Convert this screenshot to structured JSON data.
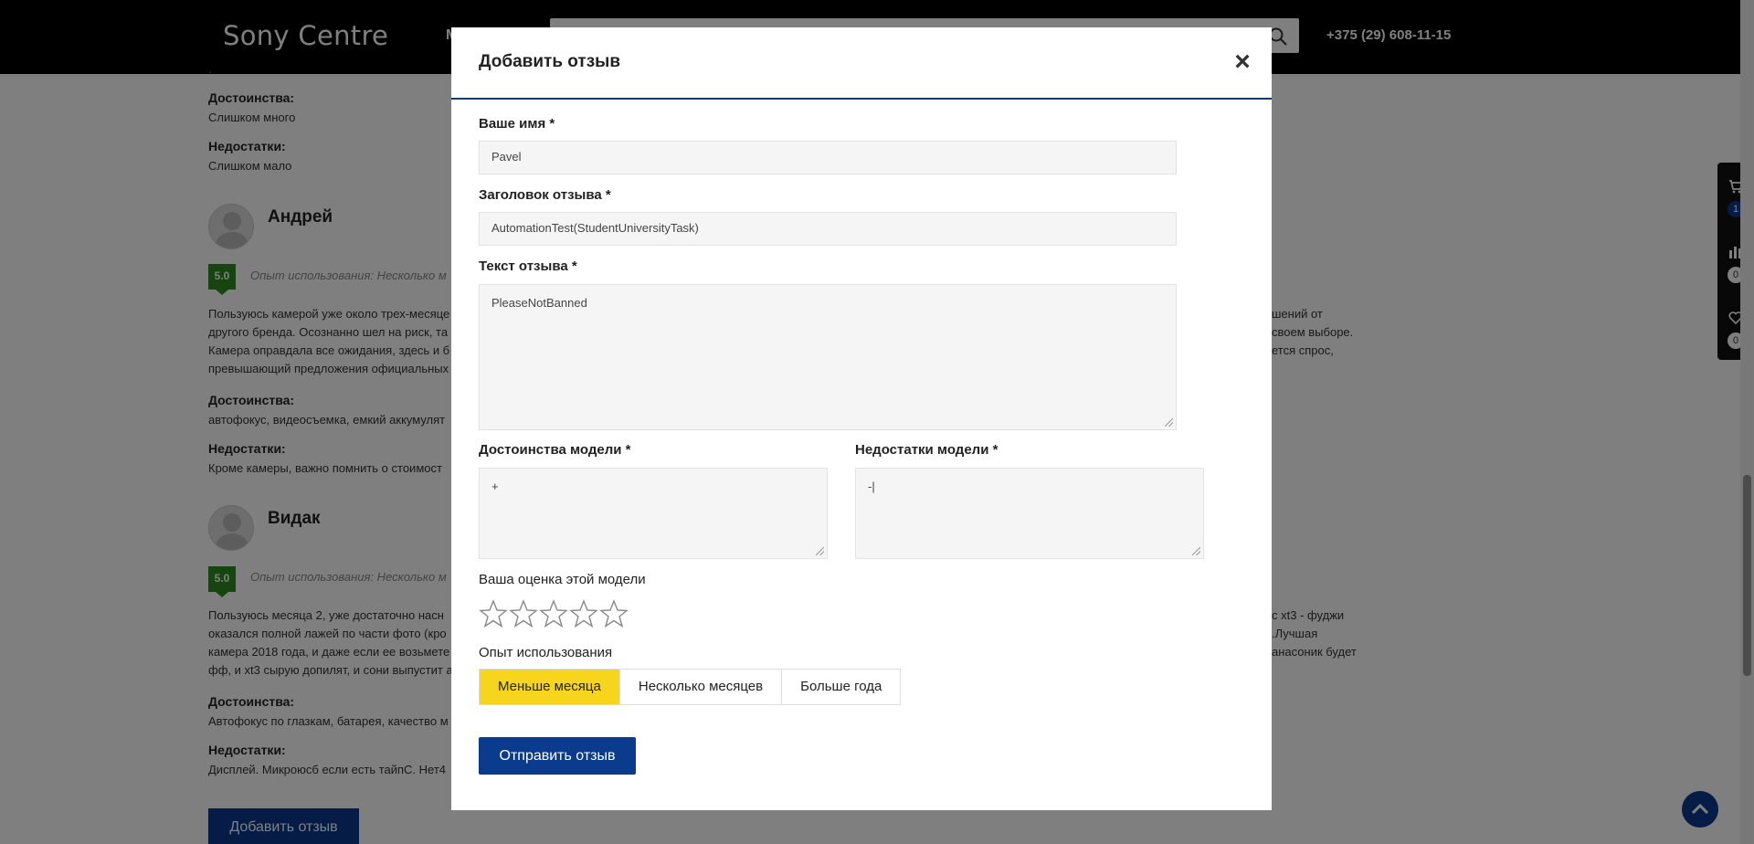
{
  "header": {
    "logo": "Sony Centre",
    "menu_peek": "М",
    "phone": "+375 (29) 608-11-15"
  },
  "reviews": {
    "first_partial": {
      "pros_label": "Достоинства:",
      "pros": "Слишком много",
      "cons_label": "Недостатки:",
      "cons": "Слишком мало"
    },
    "items": [
      {
        "name": "Андрей",
        "rating": "5.0",
        "experience": "Опыт использования: Несколько м",
        "text_lines": [
          "Пользуюсь камерой уже около трех-месяце",
          "другого бренда. Осознанно шел на риск, та",
          "Камера оправдала все ожидания, здесь и б",
          "превышающий предложения официальных"
        ],
        "text_right_lines": [
          "шений от",
          "своем выборе.",
          "ется спрос,",
          ""
        ],
        "pros_label": "Достоинства:",
        "pros": "автофокус, видеосъемка, емкий аккумулят",
        "cons_label": "Недостатки:",
        "cons": "Кроме камеры, важно помнить о стоимост"
      },
      {
        "name": "Видак",
        "rating": "5.0",
        "experience": "Опыт использования: Несколько м",
        "text_lines": [
          "Пользуюсь месяца 2, уже достаточно насн",
          "оказался полной лажей по части фото (кро",
          "камера 2018 года, и даже если ее возьмете",
          "фф, и xt3 сырую допилят, и сони выпустит а"
        ],
        "text_right_lines": [
          "с xt3 - фуджи",
          ".Лучшая",
          "анасоник будет",
          ""
        ],
        "pros_label": "Достоинства:",
        "pros": "Автофокус по глазкам, батарея, качество м",
        "cons_label": "Недостатки:",
        "cons": "Дисплей. Микроюсб если есть тайпС. Нет4"
      }
    ],
    "add_button": "Добавить отзыв"
  },
  "side_panel": {
    "cart_count": "1",
    "compare_count": "0",
    "wishlist_count": "0"
  },
  "modal": {
    "title": "Добавить отзыв",
    "close": "×",
    "name_label": "Ваше имя *",
    "name_value": "Pavel",
    "headline_label": "Заголовок отзыва *",
    "headline_value": "AutomationTest(StudentUniversityTask)",
    "text_label": "Текст отзыва *",
    "text_value": "PleaseNotBanned",
    "pros_label": "Достоинства модели *",
    "pros_value": "+",
    "cons_label": "Недостатки модели *",
    "cons_value": "-|",
    "rating_label": "Ваша оценка этой модели",
    "rating_value": 0,
    "rating_max": 5,
    "experience_label": "Опыт использования",
    "experience_options": [
      "Меньше месяца",
      "Несколько месяцев",
      "Больше года"
    ],
    "experience_selected": 0,
    "submit": "Отправить отзыв"
  },
  "colors": {
    "accent_blue": "#0a3b8c",
    "selected_yellow": "#f7d51d",
    "rating_green": "#2e8b1e"
  }
}
